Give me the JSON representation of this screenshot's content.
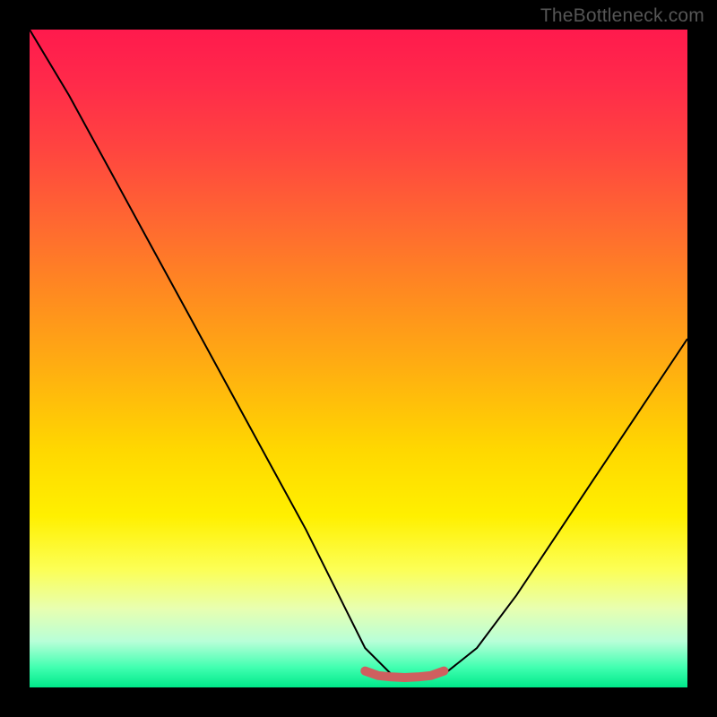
{
  "watermark": "TheBottleneck.com",
  "chart_data": {
    "type": "line",
    "title": "",
    "xlabel": "",
    "ylabel": "",
    "xlim": [
      0,
      100
    ],
    "ylim": [
      0,
      100
    ],
    "gradient_axis": "y",
    "gradient_meaning": "red-high-bottleneck to green-low-bottleneck",
    "series": [
      {
        "name": "bottleneck-curve",
        "x": [
          0,
          6,
          12,
          18,
          24,
          30,
          36,
          42,
          48,
          51,
          55,
          59,
          63,
          68,
          74,
          80,
          86,
          92,
          100
        ],
        "y": [
          100,
          90,
          79,
          68,
          57,
          46,
          35,
          24,
          12,
          6,
          2,
          1.5,
          2,
          6,
          14,
          23,
          32,
          41,
          53
        ]
      },
      {
        "name": "optimal-marker",
        "type": "scatter",
        "x": [
          51,
          53,
          55,
          57,
          59,
          61,
          63
        ],
        "y": [
          2.5,
          1.8,
          1.6,
          1.5,
          1.6,
          1.8,
          2.5
        ],
        "color": "#d46a6a"
      }
    ]
  }
}
